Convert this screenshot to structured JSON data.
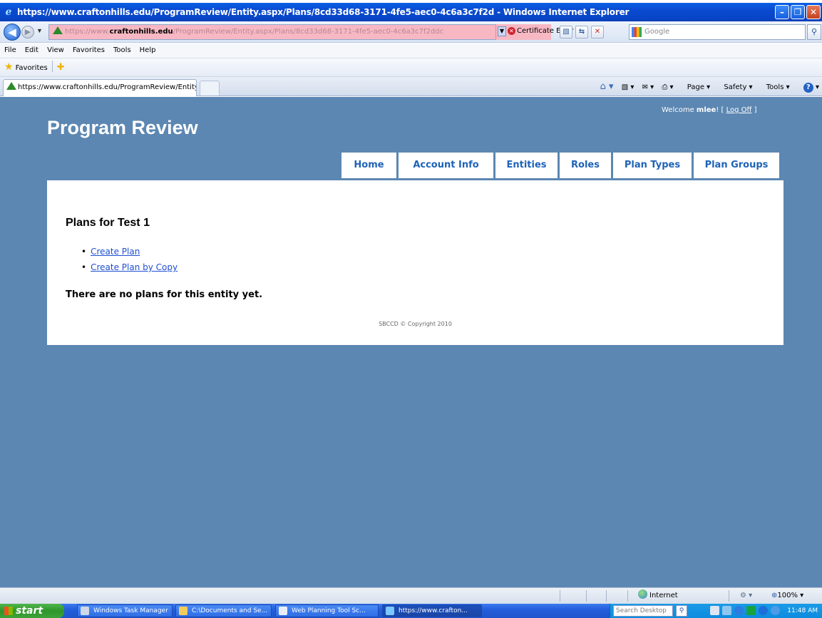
{
  "browser": {
    "window_title": "https://www.craftonhills.edu/ProgramReview/Entity.aspx/Plans/8cd33d68-3171-4fe5-aec0-4c6a3c7f2d - Windows Internet Explorer",
    "url_prefix": "https://www.",
    "url_domain": "craftonhills.edu",
    "url_path": "/ProgramReview/Entity.aspx/Plans/8cd33d68-3171-4fe5-aec0-4c6a3c7f2ddc",
    "cert_error": "Certificate Error",
    "search_placeholder": "Google",
    "menu": [
      "File",
      "Edit",
      "View",
      "Favorites",
      "Tools",
      "Help"
    ],
    "favorites_label": "Favorites",
    "tab_title": "https://www.craftonhills.edu/ProgramReview/Entity....",
    "cmd_page": "Page",
    "cmd_safety": "Safety",
    "cmd_tools": "Tools",
    "status_zone": "Internet",
    "zoom": "100%"
  },
  "site": {
    "welcome_prefix": "Welcome ",
    "user": "mlee",
    "welcome_suffix": "! [ ",
    "logoff": "Log Off",
    "welcome_end": " ]",
    "title": "Program Review",
    "nav": [
      "Home",
      "Account Info",
      "Entities",
      "Roles",
      "Plan Types",
      "Plan Groups"
    ]
  },
  "main": {
    "heading": "Plans for Test 1",
    "actions": [
      "Create Plan",
      "Create Plan by Copy"
    ],
    "empty_message": "There are no plans for this entity yet.",
    "copyright": "SBCCD © Copyright 2010"
  },
  "taskbar": {
    "start": "start",
    "items": [
      "Windows Task Manager",
      "C:\\Documents and Se...",
      "Web Planning Tool Sc...",
      "https://www.crafton..."
    ],
    "search_placeholder": "Search Desktop",
    "clock": "11:48 AM"
  }
}
